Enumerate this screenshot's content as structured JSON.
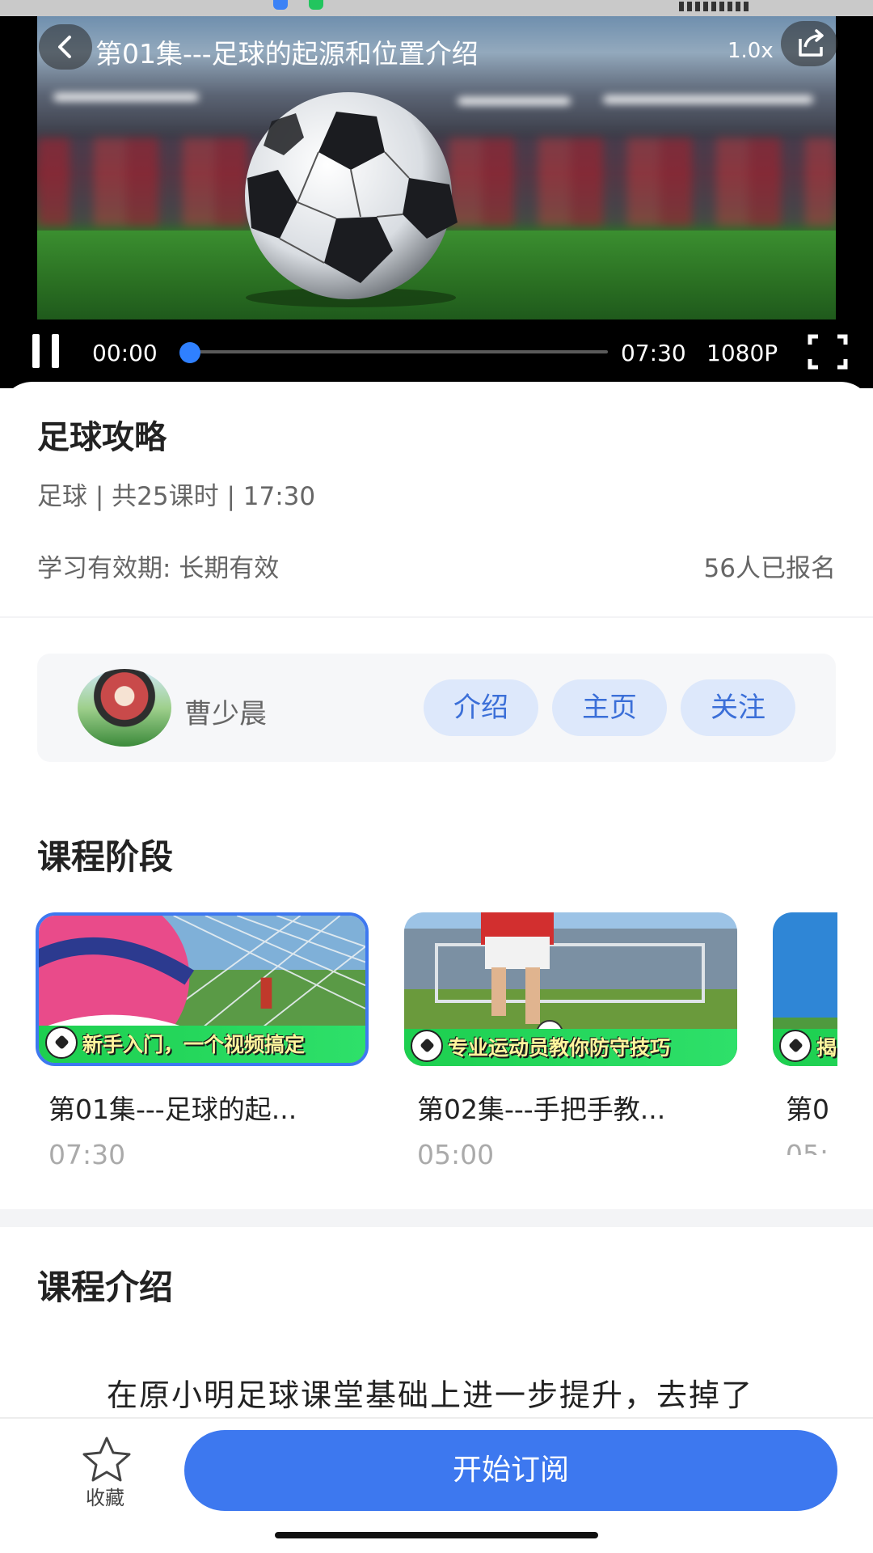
{
  "player": {
    "title": "第01集---足球的起源和位置介绍",
    "speed": "1.0x",
    "current_time": "00:00",
    "total_time": "07:30",
    "quality": "1080P",
    "progress": 0.0
  },
  "course": {
    "title": "足球攻略",
    "meta": "足球 | 共25课时 | 17:30",
    "validity": "学习有效期: 长期有效",
    "enrolled": "56人已报名"
  },
  "teacher": {
    "name": "曹少晨",
    "buttons": [
      "介绍",
      "主页",
      "关注"
    ]
  },
  "stages": {
    "title": "课程阶段",
    "episodes": [
      {
        "caption": "新手入门，一个视频搞定",
        "title": "第01集---足球的起...",
        "duration": "07:30",
        "active": true
      },
      {
        "caption": "专业运动员教你防守技巧",
        "title": "第02集---手把手教...",
        "duration": "05:00",
        "active": false
      },
      {
        "caption": "揭",
        "title": "第0",
        "duration": "05:",
        "active": false
      }
    ]
  },
  "intro": {
    "title": "课程介绍",
    "text": "在原小明足球课堂基础上进一步提升，去掉了"
  },
  "bottom": {
    "favorite_label": "收藏",
    "subscribe_label": "开始订阅"
  },
  "colors": {
    "accent": "#3d78ef",
    "chip_bg": "#dde8fb",
    "chip_text": "#3b6fd8",
    "progress": "#2f80ff"
  },
  "icons": [
    "back-icon",
    "share-icon",
    "pause-icon",
    "fullscreen-icon",
    "star-icon"
  ]
}
